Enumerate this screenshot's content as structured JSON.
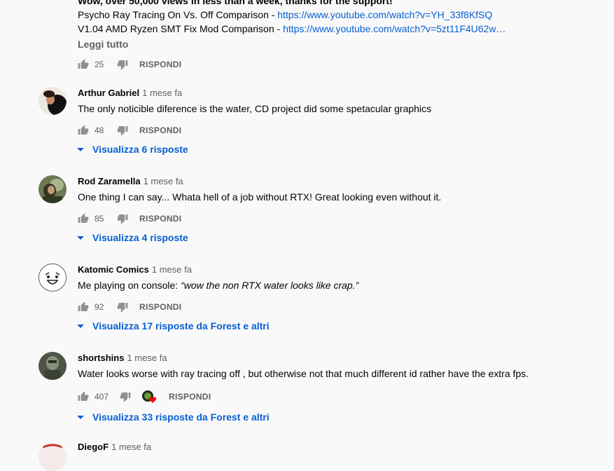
{
  "top_comment": {
    "line_partial": "Wow, over 50,000 views in less than a week, thanks for the support!",
    "line1_label": "Psycho Ray Tracing On Vs. Off Comparison - ",
    "line1_link": "https://www.youtube.com/watch?v=YH_33f8KfSQ",
    "line2_label": "V1.04 AMD Ryzen SMT Fix Mod Comparison - ",
    "line2_link": "https://www.youtube.com/watch?v=5zt11F4U62w…",
    "read_more": "Leggi tutto",
    "likes": "25",
    "reply": "RISPONDI"
  },
  "comments": [
    {
      "author": "Arthur Gabriel",
      "time": "1 mese fa",
      "text": "The only noticible diference is the water, CD project did some spetacular graphics",
      "likes": "48",
      "reply": "RISPONDI",
      "replies": "Visualizza 6 risposte"
    },
    {
      "author": "Rod Zaramella",
      "time": "1 mese fa",
      "text": "One thing I can say... Whata hell of a job without RTX! Great looking even without it.",
      "likes": "85",
      "reply": "RISPONDI",
      "replies": "Visualizza 4 risposte"
    },
    {
      "author": "Katomic Comics",
      "time": "1 mese fa",
      "text_prefix": "Me playing on console: ",
      "text_italic": "“wow the non RTX water looks like crap.”",
      "likes": "92",
      "reply": "RISPONDI",
      "replies": "Visualizza 17 risposte da Forest e altri"
    },
    {
      "author": "shortshins",
      "time": "1 mese fa",
      "text": "Water looks worse with ray tracing off , but otherwise not that much different id rather have the extra fps.",
      "likes": "407",
      "reply": "RISPONDI",
      "replies": "Visualizza 33 risposte da Forest e altri"
    },
    {
      "author": "DiegoF",
      "time": "1 mese fa"
    }
  ],
  "colors": {
    "link": "#065fd4",
    "secondary": "#606060",
    "background": "#f9f9f9",
    "heart": "#ff0000"
  },
  "icons": {
    "like": "thumb-up-icon",
    "dislike": "thumb-down-icon",
    "expand": "caret-down-icon",
    "creator_heart": "creator-heart-icon"
  }
}
